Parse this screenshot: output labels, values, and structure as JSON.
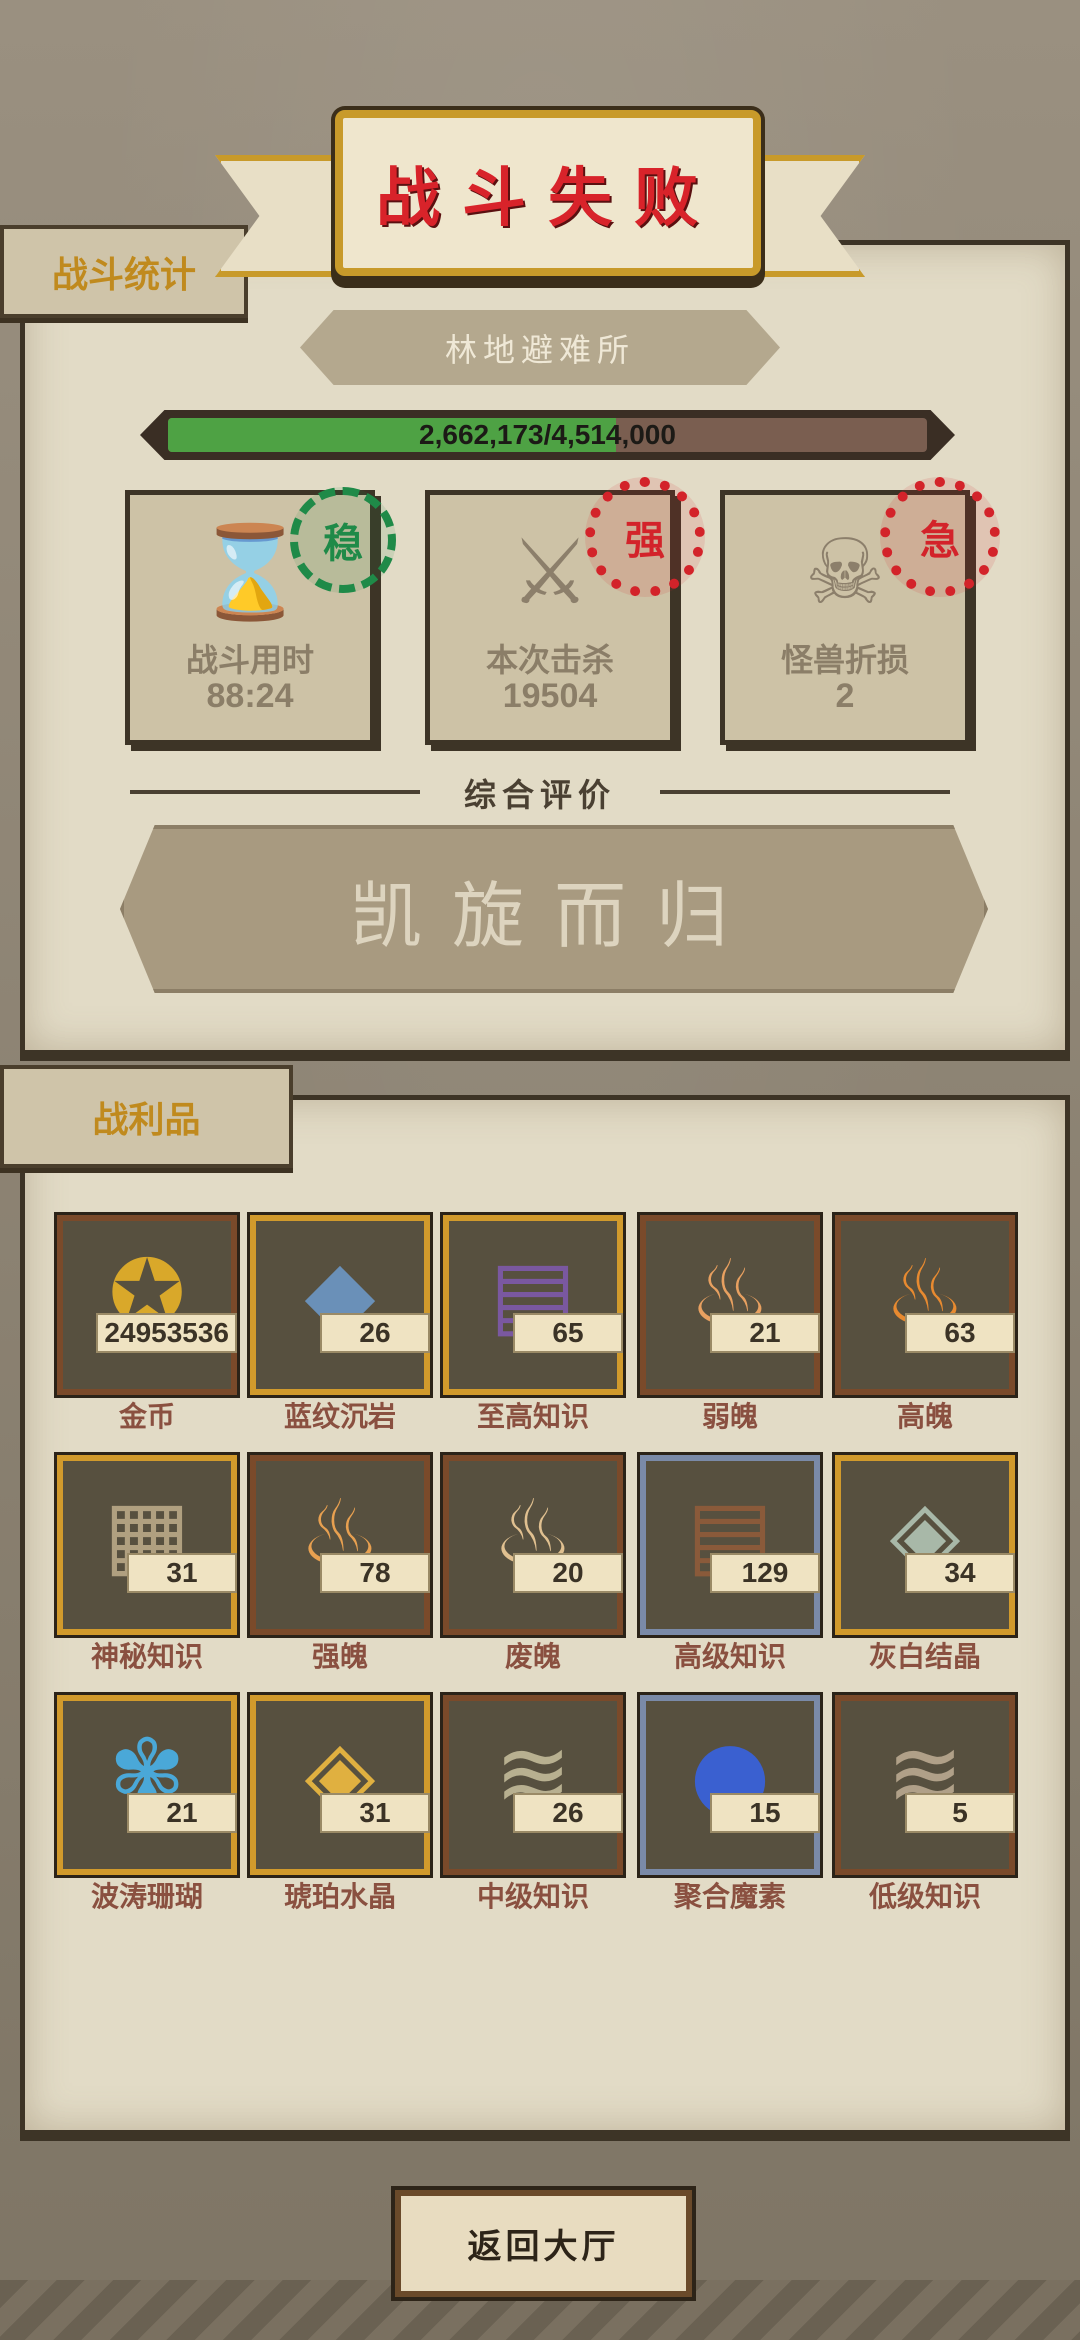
{
  "header": {
    "title": "战斗失败"
  },
  "sections": {
    "stats_label": "战斗统计",
    "loot_label": "战利品"
  },
  "location": {
    "name": "林地避难所"
  },
  "progress": {
    "text": "2,662,173/4,514,000",
    "current": 2662173,
    "total": 4514000,
    "fill_color": "#4ea244"
  },
  "stats": [
    {
      "label": "战斗用时",
      "value": "88:24",
      "icon": "hourglass-icon",
      "stamp": "稳",
      "stamp_color": "#1f8a48"
    },
    {
      "label": "本次击杀",
      "value": "19504",
      "icon": "crossed-swords-icon",
      "stamp": "强",
      "stamp_color": "#d3232a"
    },
    {
      "label": "怪兽折损",
      "value": "2",
      "icon": "skull-icon",
      "stamp": "急",
      "stamp_color": "#d3232a"
    }
  ],
  "evaluation": {
    "label": "综合评价",
    "result": "凯旋而归"
  },
  "loot": [
    {
      "name": "金币",
      "count": "24953536",
      "icon": "gold-coin-icon",
      "rarity": "common"
    },
    {
      "name": "蓝纹沉岩",
      "count": "26",
      "icon": "blue-rock-icon",
      "rarity": "gold"
    },
    {
      "name": "至高知识",
      "count": "65",
      "icon": "supreme-book-icon",
      "rarity": "gold"
    },
    {
      "name": "弱魄",
      "count": "21",
      "icon": "small-flame-icon",
      "rarity": "common"
    },
    {
      "name": "高魄",
      "count": "63",
      "icon": "big-flame-icon",
      "rarity": "common"
    },
    {
      "name": "神秘知识",
      "count": "31",
      "icon": "mystic-tablet-icon",
      "rarity": "gold"
    },
    {
      "name": "强魄",
      "count": "78",
      "icon": "strong-flame-icon",
      "rarity": "common"
    },
    {
      "name": "废魄",
      "count": "20",
      "icon": "dim-flame-icon",
      "rarity": "common"
    },
    {
      "name": "高级知识",
      "count": "129",
      "icon": "advanced-book-icon",
      "rarity": "blue"
    },
    {
      "name": "灰白结晶",
      "count": "34",
      "icon": "grey-crystal-icon",
      "rarity": "gold"
    },
    {
      "name": "波涛珊瑚",
      "count": "21",
      "icon": "coral-icon",
      "rarity": "gold"
    },
    {
      "name": "琥珀水晶",
      "count": "31",
      "icon": "amber-crystal-icon",
      "rarity": "gold"
    },
    {
      "name": "中级知识",
      "count": "26",
      "icon": "scroll-icon",
      "rarity": "common"
    },
    {
      "name": "聚合魔素",
      "count": "15",
      "icon": "magic-orb-icon",
      "rarity": "blue"
    },
    {
      "name": "低级知识",
      "count": "5",
      "icon": "parchment-icon",
      "rarity": "common"
    }
  ],
  "footer": {
    "return_label": "返回大厅"
  }
}
